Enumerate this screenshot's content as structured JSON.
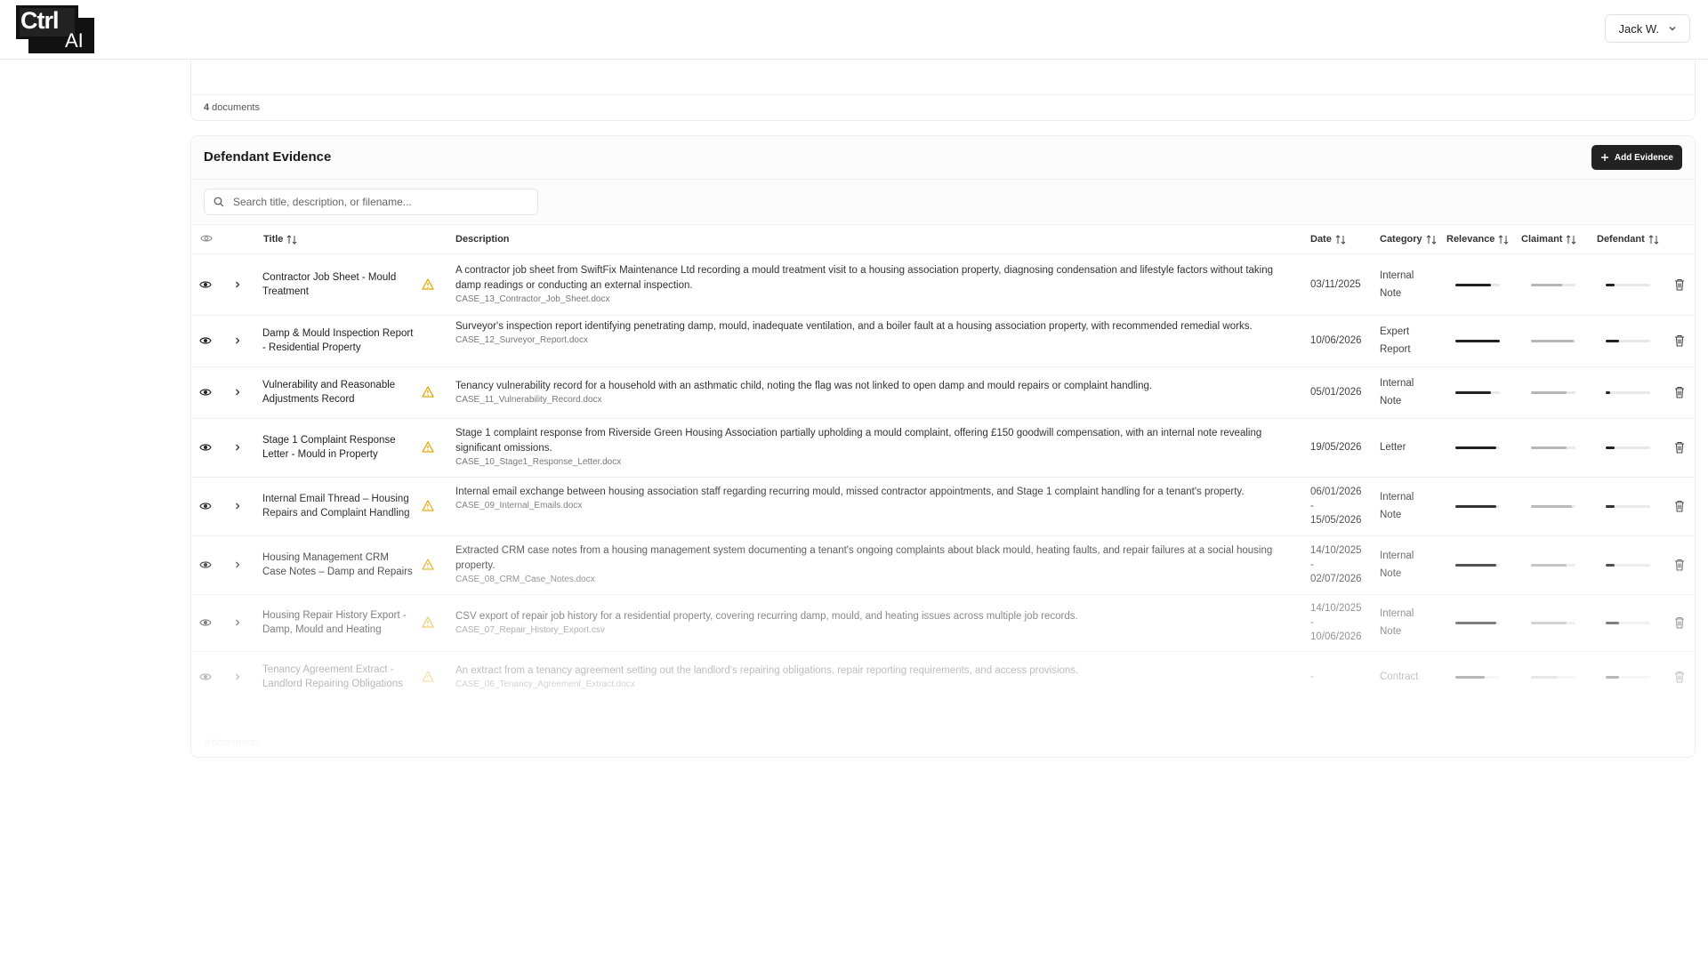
{
  "header": {
    "logo_line1": "Ctrl",
    "logo_line2": "AI",
    "user_name": "Jack W."
  },
  "previous_section": {
    "count_number": "4",
    "count_label": " documents"
  },
  "section": {
    "title": "Defendant Evidence",
    "add_button_label": "Add Evidence",
    "search_placeholder": "Search title, description, or filename..."
  },
  "columns": {
    "title": "Title",
    "description": "Description",
    "date": "Date",
    "category": "Category",
    "relevance": "Relevance",
    "claimant": "Claimant",
    "defendant": "Defendant"
  },
  "rows": [
    {
      "title": "Contractor Job Sheet - Mould Treatment",
      "description": "A contractor job sheet from SwiftFix Maintenance Ltd recording a mould treatment visit to a housing association property, diagnosing condensation and lifestyle factors without taking damp readings or conducting an external inspection.",
      "filename": "CASE_13_Contractor_Job_Sheet.docx",
      "date_line1": "03/11/2025",
      "date_line2": "",
      "date_line3": "",
      "category_line1": "Internal",
      "category_line2": "Note",
      "warning": true,
      "relevance": 0.8,
      "claimant": 0.7,
      "defendant": 0.2
    },
    {
      "title": "Damp & Mould Inspection Report - Residential Property",
      "description": "Surveyor's inspection report identifying penetrating damp, mould, inadequate ventilation, and a boiler fault at a housing association property, with recommended remedial works.",
      "filename": "CASE_12_Surveyor_Report.docx",
      "date_line1": "10/06/2026",
      "date_line2": "",
      "date_line3": "",
      "category_line1": "Expert",
      "category_line2": "Report",
      "warning": false,
      "relevance": 1.0,
      "claimant": 0.95,
      "defendant": 0.3
    },
    {
      "title": "Vulnerability and Reasonable Adjustments Record",
      "description": "Tenancy vulnerability record for a household with an asthmatic child, noting the flag was not linked to open damp and mould repairs or complaint handling.",
      "filename": "CASE_11_Vulnerability_Record.docx",
      "date_line1": "05/01/2026",
      "date_line2": "",
      "date_line3": "",
      "category_line1": "Internal",
      "category_line2": "Note",
      "warning": true,
      "relevance": 0.8,
      "claimant": 0.8,
      "defendant": 0.1
    },
    {
      "title": "Stage 1 Complaint Response Letter - Mould in Property",
      "description": "Stage 1 complaint response from Riverside Green Housing Association partially upholding a mould complaint, offering £150 goodwill compensation, with an internal note revealing significant omissions.",
      "filename": "CASE_10_Stage1_Response_Letter.docx",
      "date_line1": "19/05/2026",
      "date_line2": "",
      "date_line3": "",
      "category_line1": "Letter",
      "category_line2": "",
      "warning": true,
      "relevance": 0.92,
      "claimant": 0.8,
      "defendant": 0.2
    },
    {
      "title": "Internal Email Thread – Housing Repairs and Complaint Handling",
      "description": "Internal email exchange between housing association staff regarding recurring mould, missed contractor appointments, and Stage 1 complaint handling for a tenant's property.",
      "filename": "CASE_09_Internal_Emails.docx",
      "date_line1": "06/01/2026",
      "date_line2": "-",
      "date_line3": "15/05/2026",
      "category_line1": "Internal",
      "category_line2": "Note",
      "warning": true,
      "relevance": 0.92,
      "claimant": 0.92,
      "defendant": 0.2
    },
    {
      "title": "Housing Management CRM Case Notes – Damp and Repairs",
      "description": "Extracted CRM case notes from a housing management system documenting a tenant's ongoing complaints about black mould, heating faults, and repair failures at a social housing property.",
      "filename": "CASE_08_CRM_Case_Notes.docx",
      "date_line1": "14/10/2025",
      "date_line2": "-",
      "date_line3": "02/07/2026",
      "category_line1": "Internal",
      "category_line2": "Note",
      "warning": true,
      "relevance": 0.92,
      "claimant": 0.8,
      "defendant": 0.2
    },
    {
      "title": "Housing Repair History Export - Damp, Mould and Heating",
      "description": "CSV export of repair job history for a residential property, covering recurring damp, mould, and heating issues across multiple job records.",
      "filename": "CASE_07_Repair_History_Export.csv",
      "date_line1": "14/10/2025",
      "date_line2": "-",
      "date_line3": "10/06/2026",
      "category_line1": "Internal",
      "category_line2": "Note",
      "warning": true,
      "relevance": 0.92,
      "claimant": 0.8,
      "defendant": 0.3
    },
    {
      "title": "Tenancy Agreement Extract - Landlord Repairing Obligations",
      "description": "An extract from a tenancy agreement setting out the landlord's repairing obligations, repair reporting requirements, and access provisions.",
      "filename": "CASE_06_Tenancy_Agreement_Extract.docx",
      "date_line1": "-",
      "date_line2": "",
      "date_line3": "",
      "category_line1": "Contract",
      "category_line2": "",
      "warning": true,
      "relevance": 0.65,
      "claimant": 0.6,
      "defendant": 0.3
    }
  ],
  "footer_count": "8 documents",
  "colors": {
    "button_bg": "#222222",
    "warning": "#e0a800",
    "bar_dark": "#222222",
    "bar_light": "#b5b5b5",
    "bar_track": "#e8e8e8"
  }
}
